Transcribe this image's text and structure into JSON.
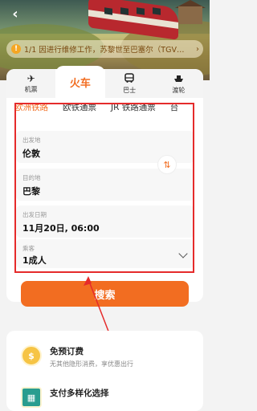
{
  "notice": {
    "text": "1/1 因进行维修工作，苏黎世至巴塞尔（TGV…"
  },
  "mode_tabs": [
    {
      "label": "机票",
      "icon": "plane-icon"
    },
    {
      "label": "火车",
      "icon": "train-icon"
    },
    {
      "label": "巴士",
      "icon": "bus-icon"
    },
    {
      "label": "渡轮",
      "icon": "ferry-icon"
    }
  ],
  "sub_tabs": [
    "欧洲铁路",
    "欧铁通票",
    "JR 铁路通票",
    "台"
  ],
  "form": {
    "origin_label": "出发地",
    "origin_value": "伦敦",
    "destination_label": "目的地",
    "destination_value": "巴黎",
    "date_label": "出发日期",
    "date_value": "11月20日, 06:00",
    "passenger_label": "乘客",
    "passenger_value": "1成人"
  },
  "search_button": "搜索",
  "promos": [
    {
      "title": "免预订费",
      "desc": "无其他隐形消费，享优惠出行"
    },
    {
      "title": "支付多样化选择",
      "desc": ""
    }
  ],
  "colors": {
    "accent": "#f26d21",
    "highlight": "#e52b2b"
  }
}
